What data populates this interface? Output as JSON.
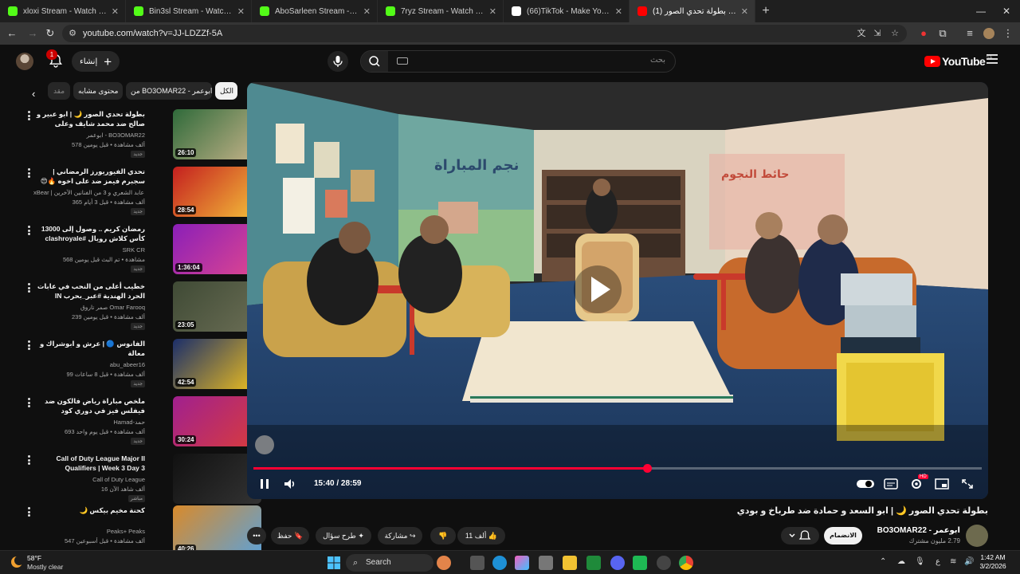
{
  "browser": {
    "tabs": [
      {
        "title": "xloxi Stream - Watch Live on Ki",
        "fav_color": "#53fc18"
      },
      {
        "title": "Bin3sl Stream - Watch Live on K",
        "fav_color": "#53fc18"
      },
      {
        "title": "AboSarleen Stream - Watch Liv",
        "fav_color": "#53fc18"
      },
      {
        "title": "7ryz Stream - Watch Live on Ki",
        "fav_color": "#53fc18"
      },
      {
        "title": "(66)TikTok - Make Your Day",
        "fav_color": "#ffffff"
      },
      {
        "title": "(1) بطولة تحدي الصور 🌙 |",
        "fav_color": "#ff0000",
        "active": true
      }
    ],
    "new_tab_label": "+",
    "url": "youtube.com/watch?v=JJ-LDZZf-5A"
  },
  "yt_header": {
    "notification_count": "1",
    "create_label": "إنشاء",
    "search_placeholder": "بحث",
    "logo_text": "YouTube",
    "region": "SA"
  },
  "chips": [
    {
      "label": "الكل",
      "active": true
    },
    {
      "label": "من BO3OMAR22 - ابوعمر"
    },
    {
      "label": "محتوى مشابه"
    },
    {
      "label": "مقد"
    }
  ],
  "recommendations": [
    {
      "title": "بطولة تحدي الصور 🌙 | ابو عبير و صالح ضد محمد شايف وعلى",
      "channel": "ابوعمر - BO3OMAR22",
      "meta": "578 ألف مشاهدة • قبل يومين",
      "badge": "جديد",
      "duration": "26:10",
      "thumb": [
        "#2f6a3a",
        "#c7b48a"
      ]
    },
    {
      "title": "تحدي الفيوريورز الرمضاني | سجبرم فيمز ضد على اخوه 🔥😍",
      "channel": "xBear | ابو عابد الشعري و 3 من الفنانين الآخرين",
      "meta": "365 ألف مشاهدة • قبل 3 أيام",
      "badge": "جديد",
      "duration": "28:54",
      "thumb": [
        "#c41f1f",
        "#f5c23a"
      ]
    },
    {
      "title": "رمضان كريم .. وصول إلى 13000 كأس كلاش رويال #clashroyale #shorts",
      "channel": "SRK CR",
      "meta": "568 مشاهدة • تم البث قبل يومين",
      "badge": "جديد",
      "duration": "1:36:04",
      "thumb": [
        "#8a1fb8",
        "#e0478f"
      ]
    },
    {
      "title": "خطيب أعلى من النحب في عابات الحرد الهندية #عبر_بحرب IN",
      "channel": "صمر تاروق Omar Farooq",
      "meta": "239 ألف مشاهدة • قبل يومين",
      "badge": "جديد",
      "duration": "23:05",
      "thumb": [
        "#3f4a35",
        "#6b6e55"
      ]
    },
    {
      "title": "الفانوس 🔵 | عرش و ابوشراك و معالة",
      "channel": "abu_abeer16",
      "meta": "99 ألف مشاهدة • قبل 8 ساعات",
      "badge": "جديد",
      "duration": "42:54",
      "thumb": [
        "#1b2e6a",
        "#f2c21e"
      ]
    },
    {
      "title": "ملخص مباراة رياض فالكون ضد فيفلس فيز في دوري كود العالمي| Riyadh Falcons...",
      "channel": "Hamad-حمد",
      "meta": "693 ألف مشاهدة • قبل يوم واحد",
      "badge": "جديد",
      "duration": "30:24",
      "thumb": [
        "#a0208f",
        "#d93c3c"
      ]
    },
    {
      "title": "Call of Duty League Major II Qualifiers | Week 3 Day 3",
      "channel": "Call of Duty League",
      "meta": "16 ألف شاهد الآن",
      "badge": "مباشر",
      "duration": "",
      "thumb": [
        "#111111",
        "#333333"
      ]
    },
    {
      "title": "كحنة مخيم بيكس 🌙",
      "channel": "Peaks+ Peaks",
      "meta": "547 ألف مشاهدة • قبل أسبوعين",
      "badge": "",
      "duration": "40:26",
      "thumb": [
        "#d98a2a",
        "#5ea1d6"
      ]
    }
  ],
  "player": {
    "current_time": "15:40",
    "duration": "28:59",
    "time_display": "15:40 / 28:59",
    "progress_fraction": 0.54,
    "hd_badge": "HD"
  },
  "video": {
    "title": "بطولة تحدي الصور 🌙 | ابو السعد و حمادة ضد طرباخ و بودي",
    "channel_name": "ابوعمر - BO3OMAR22",
    "subscribers": "2.79 مليون مشترك",
    "join_label": "الانضمام",
    "likes": "11 ألف",
    "share_label": "مشاركة",
    "ask_label": "طرح سؤال",
    "save_label": "حفظ"
  },
  "taskbar": {
    "temperature": "58°F",
    "weather": "Mostly clear",
    "search_label": "Search",
    "time": "1:42 AM",
    "date": "3/2/2026",
    "lang": "ع"
  }
}
